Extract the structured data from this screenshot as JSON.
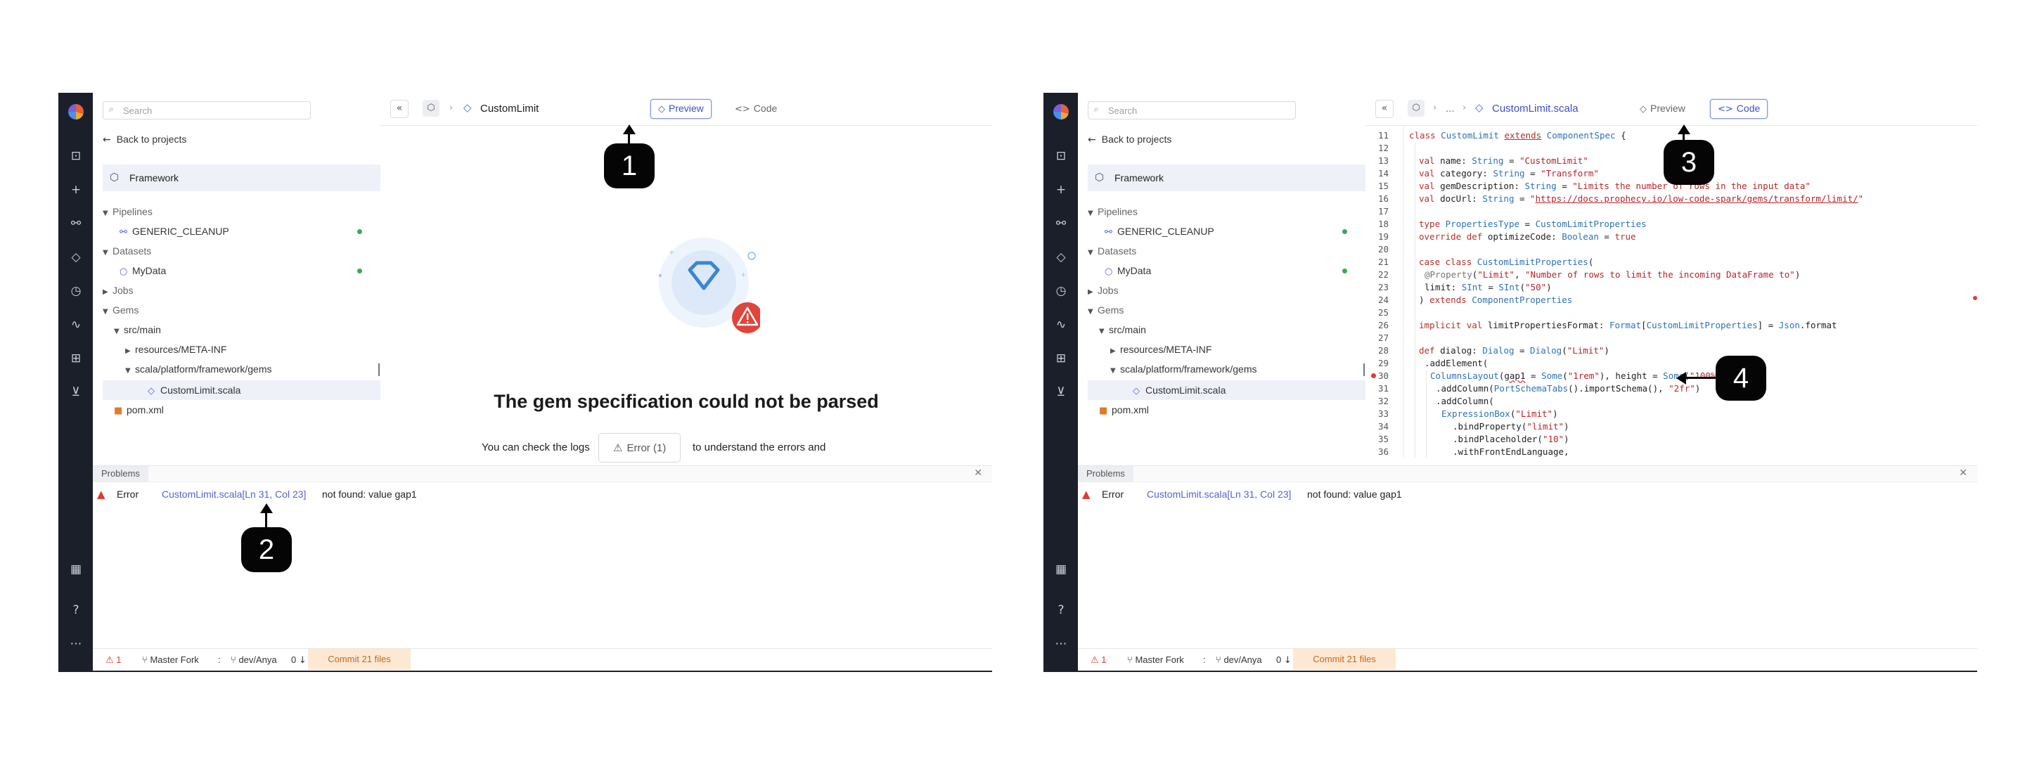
{
  "left": {
    "search_placeholder": "Search",
    "back_label": "Back to projects",
    "project_name": "Framework",
    "tree": {
      "pipelines": "Pipelines",
      "pipeline_item": "GENERIC_CLEANUP",
      "datasets": "Datasets",
      "dataset_item": "MyData",
      "jobs": "Jobs",
      "gems": "Gems",
      "src_main": "src/main",
      "resources": "resources/META-INF",
      "scala_path": "scala/platform/framework/gems",
      "file": "CustomLimit.scala",
      "pom": "pom.xml"
    },
    "breadcrumb": "CustomLimit",
    "tabs": {
      "preview": "Preview",
      "code": "Code"
    },
    "empty_title": "The gem specification could not be parsed",
    "check_prefix": "You can check the logs",
    "error_button": "Error (1)",
    "check_suffix": "to understand the errors and"
  },
  "right": {
    "search_placeholder": "Search",
    "back_label": "Back to projects",
    "project_name": "Framework",
    "tree": {
      "pipelines": "Pipelines",
      "pipeline_item": "GENERIC_CLEANUP",
      "datasets": "Datasets",
      "dataset_item": "MyData",
      "jobs": "Jobs",
      "gems": "Gems",
      "src_main": "src/main",
      "resources": "resources/META-INF",
      "scala_path": "scala/platform/framework/gems",
      "file": "CustomLimit.scala",
      "pom": "pom.xml"
    },
    "breadcrumb_ellipsis": "...",
    "breadcrumb": "CustomLimit.scala",
    "tabs": {
      "preview": "Preview",
      "code": "Code"
    },
    "line_numbers": [
      "11",
      "12",
      "13",
      "14",
      "15",
      "16",
      "17",
      "18",
      "19",
      "20",
      "21",
      "22",
      "23",
      "24",
      "25",
      "26",
      "27",
      "28",
      "29",
      "30",
      "31",
      "32",
      "33",
      "34",
      "35",
      "36"
    ]
  },
  "problems": {
    "tab": "Problems",
    "level": "Error",
    "location": "CustomLimit.scala[Ln 31, Col 23]",
    "message": "not found: value gap1"
  },
  "status": {
    "error_count": "1",
    "fork": "Master Fork",
    "branch": "dev/Anya",
    "pull_count": "0",
    "commit": "Commit 21 files"
  },
  "callouts": [
    "1",
    "2",
    "3",
    "4"
  ],
  "colors": {
    "accent": "#3d4fc7",
    "error": "#e0382f",
    "success": "#39a858",
    "rail": "#1b1f2a",
    "commit_bg": "#fde8d3"
  },
  "icons": [
    "prophecy-logo",
    "folder-search-icon",
    "plus-icon",
    "pipeline-icon",
    "gem-icon",
    "clock-icon",
    "pulse-icon",
    "scan-icon",
    "download-icon",
    "grid-icon",
    "help-icon",
    "more-icon"
  ]
}
